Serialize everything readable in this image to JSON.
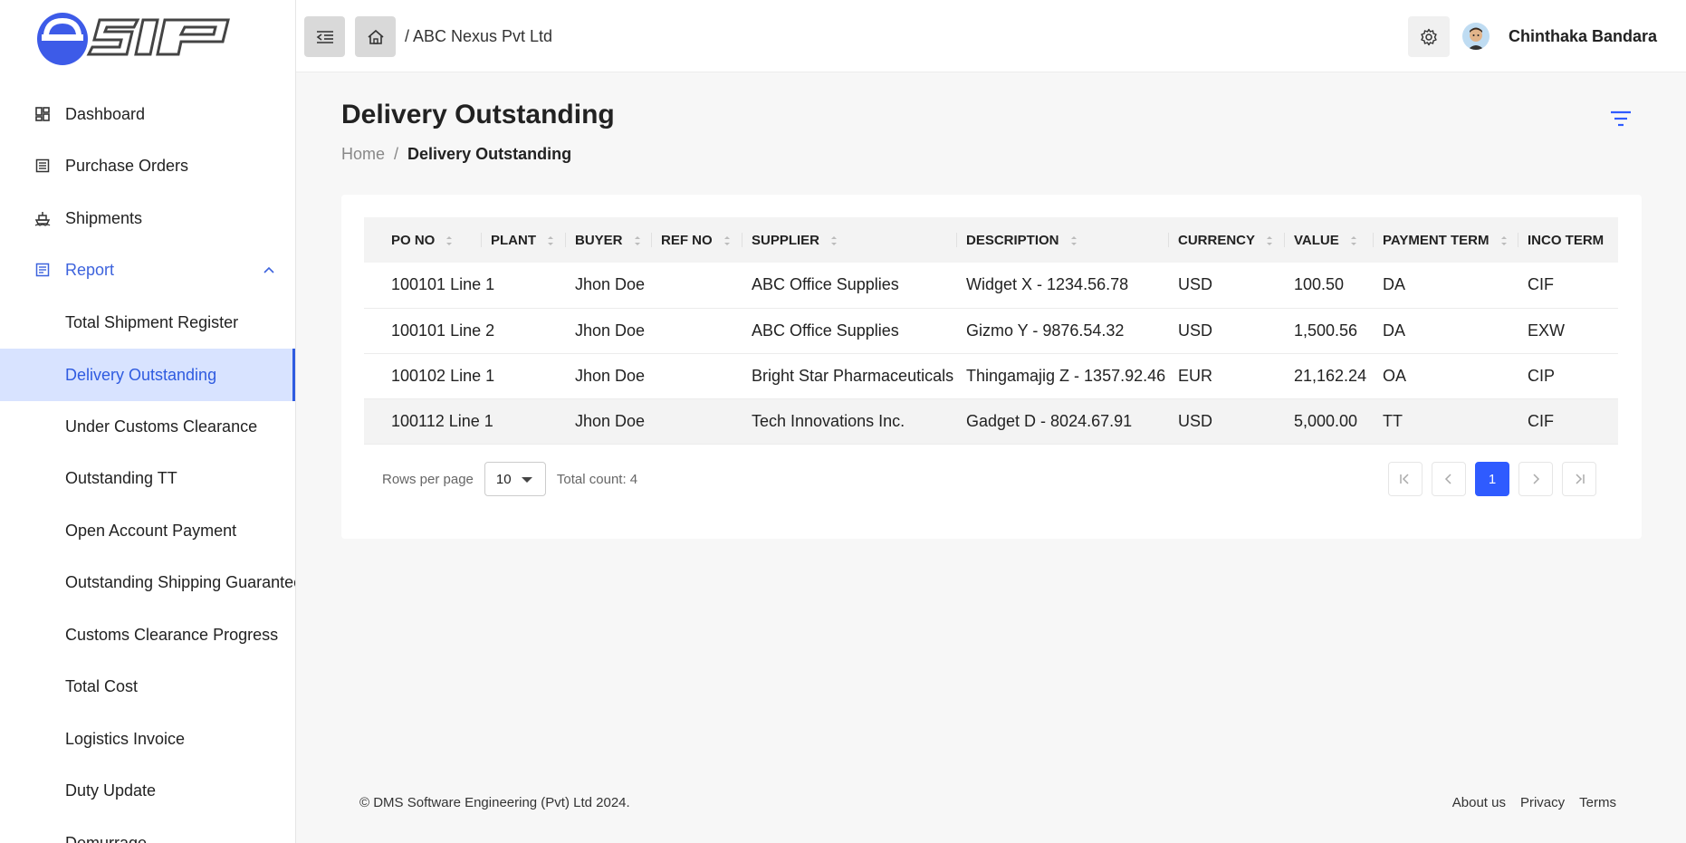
{
  "app": {
    "logo_text": "esip"
  },
  "sidebar": {
    "items": [
      {
        "label": "Dashboard",
        "icon": "dashboard-icon"
      },
      {
        "label": "Purchase Orders",
        "icon": "list-icon"
      },
      {
        "label": "Shipments",
        "icon": "ship-icon"
      },
      {
        "label": "Report",
        "icon": "report-icon"
      }
    ],
    "report_sub": [
      "Total Shipment Register",
      "Delivery Outstanding",
      "Under Customs Clearance",
      "Outstanding TT",
      "Open Account Payment",
      "Outstanding Shipping Guarantee",
      "Customs Clearance Progress",
      "Total Cost",
      "Logistics Invoice",
      "Duty Update",
      "Demurrage"
    ]
  },
  "header": {
    "crumb": "/ ABC Nexus Pvt Ltd",
    "user_name": "Chinthaka Bandara"
  },
  "page": {
    "title": "Delivery Outstanding",
    "breadcrumb": {
      "home": "Home",
      "sep": "/",
      "current": "Delivery Outstanding"
    }
  },
  "table": {
    "columns": [
      "PO NO",
      "PLANT",
      "BUYER",
      "REF NO",
      "SUPPLIER",
      "DESCRIPTION",
      "CURRENCY",
      "VALUE",
      "PAYMENT TERM",
      "INCO TERM"
    ],
    "rows": [
      [
        "100101 Line 1",
        "",
        "Jhon Doe",
        "",
        "ABC Office Supplies",
        "Widget X - 1234.56.78",
        "USD",
        "100.50",
        "DA",
        "CIF"
      ],
      [
        "100101 Line 2",
        "",
        "Jhon Doe",
        "",
        "ABC Office Supplies",
        "Gizmo Y - 9876.54.32",
        "USD",
        "1,500.56",
        "DA",
        "EXW"
      ],
      [
        "100102 Line 1",
        "",
        "Jhon Doe",
        "",
        "Bright Star Pharmaceuticals",
        "Thingamajig Z - 1357.92.46",
        "EUR",
        "21,162.24",
        "OA",
        "CIP"
      ],
      [
        "100112 Line 1",
        "",
        "Jhon Doe",
        "",
        "Tech Innovations Inc.",
        "Gadget D - 8024.67.91",
        "USD",
        "5,000.00",
        "TT",
        "CIF"
      ]
    ]
  },
  "pager": {
    "rows_label": "Rows per page",
    "rows_value": "10",
    "total": "Total count: 4",
    "current_page": "1"
  },
  "footer": {
    "copyright": "© DMS Software Engineering (Pvt) Ltd 2024.",
    "links": [
      "About us",
      "Privacy",
      "Terms"
    ]
  },
  "colors": {
    "accent": "#2f5bff",
    "selected_bg": "#d8e3ff"
  }
}
